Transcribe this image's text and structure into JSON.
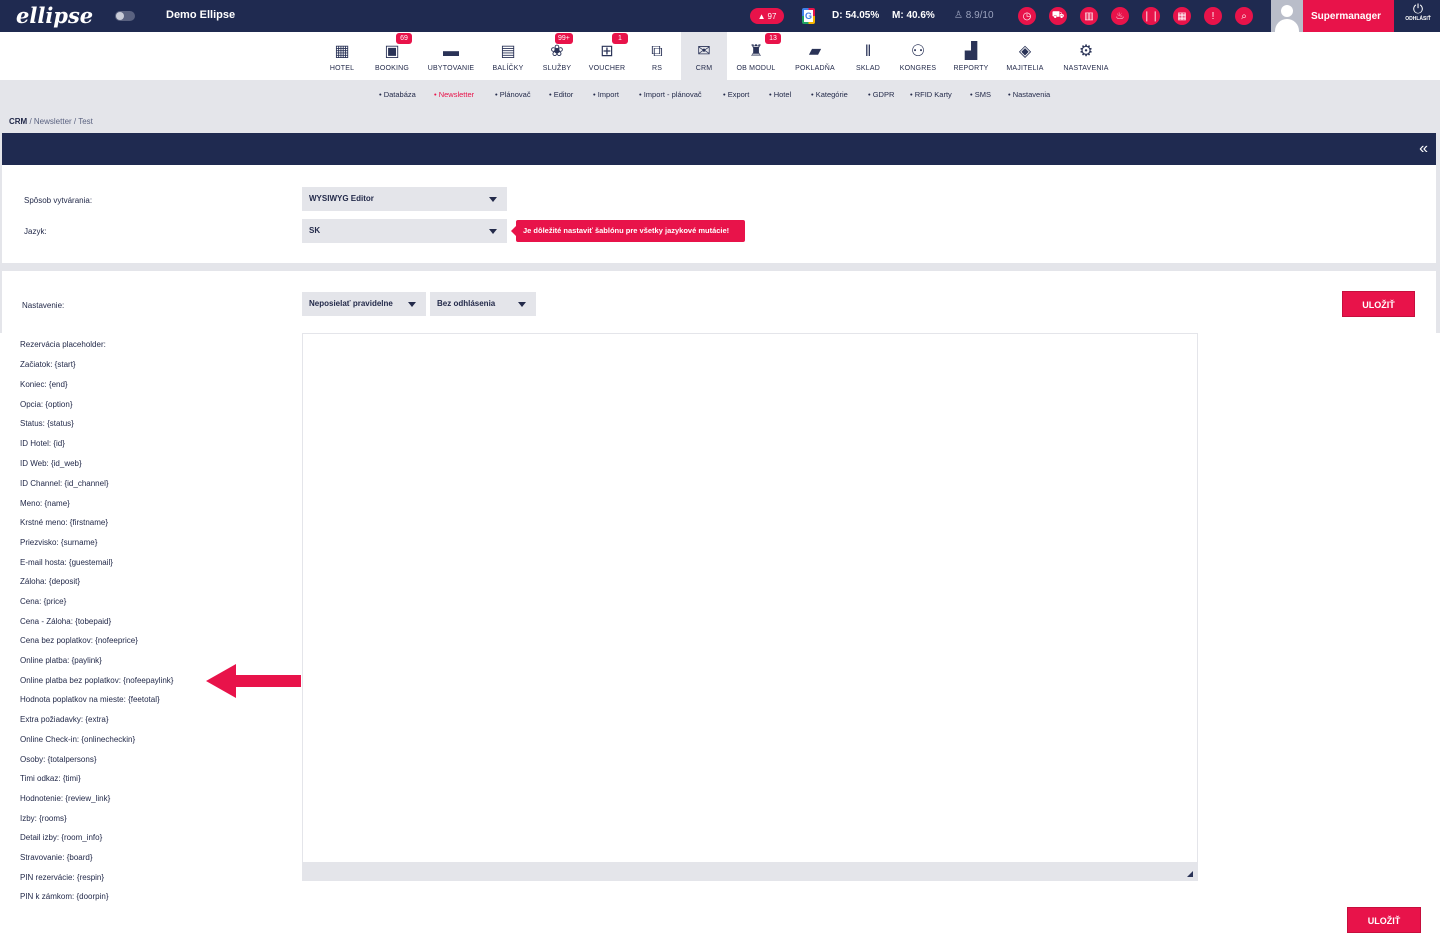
{
  "topbar": {
    "logo": "ellipse",
    "demo_label": "Demo Ellipse",
    "alerts_count": "97",
    "occupancy_day": "D: 54.05%",
    "occupancy_month": "M: 40.6%",
    "rating": "8.9/10",
    "user_name": "Supermanager",
    "logout_label": "ODHLÁSIŤ",
    "icons": [
      "clock-24-icon",
      "car-icon",
      "chart-icon",
      "restaurant-icon",
      "cutlery-icon",
      "calendar-icon",
      "alert-icon",
      "search-icon"
    ]
  },
  "modules": [
    {
      "label": "HOTEL",
      "icon": "building-icon",
      "badge": ""
    },
    {
      "label": "BOOKING",
      "icon": "calendar-icon",
      "badge": "69"
    },
    {
      "label": "UBYTOVANIE",
      "icon": "bed-icon",
      "badge": ""
    },
    {
      "label": "BALÍČKY",
      "icon": "package-icon",
      "badge": ""
    },
    {
      "label": "SLUŽBY",
      "icon": "spa-icon",
      "badge": "99+"
    },
    {
      "label": "VOUCHER",
      "icon": "gift-icon",
      "badge": "1"
    },
    {
      "label": "RS",
      "icon": "code-icon",
      "badge": ""
    },
    {
      "label": "CRM",
      "icon": "envelope-icon",
      "badge": ""
    },
    {
      "label": "OB MODUL",
      "icon": "store-icon",
      "badge": "13"
    },
    {
      "label": "POKLADŇA",
      "icon": "wallet-icon",
      "badge": ""
    },
    {
      "label": "SKLAD",
      "icon": "cutlery-icon",
      "badge": ""
    },
    {
      "label": "KONGRES",
      "icon": "people-icon",
      "badge": ""
    },
    {
      "label": "REPORTY",
      "icon": "report-icon",
      "badge": ""
    },
    {
      "label": "MAJITELIA",
      "icon": "handshake-icon",
      "badge": ""
    },
    {
      "label": "NASTAVENIA",
      "icon": "gears-icon",
      "badge": ""
    }
  ],
  "subnav": [
    "• Databáza",
    "• Newsletter",
    "• Plánovač",
    "• Editor",
    "• Import",
    "• Import - plánovač",
    "• Export",
    "• Hotel",
    "• Kategórie",
    "• GDPR",
    "• RFID Karty",
    "• SMS",
    "• Nastavenia"
  ],
  "breadcrumb": {
    "root": "CRM",
    "rest": " / Newsletter / Test"
  },
  "form": {
    "creation_label": "Spôsob vytvárania:",
    "creation_value": "WYSIWYG Editor",
    "language_label": "Jazyk:",
    "language_value": "SK",
    "language_tooltip": "Je dôležité nastaviť šablónu pre všetky jazykové mutácie!",
    "settings_label": "Nastavenie:",
    "schedule_value": "Neposielať pravidelne",
    "unsubscribe_value": "Bez odhlásenia",
    "save_label": "ULOŽIŤ"
  },
  "placeholders": [
    "Rezervácia placeholder:",
    "Začiatok: {start}",
    "Koniec: {end}",
    "Opcia: {option}",
    "Status: {status}",
    "ID Hotel: {id}",
    "ID Web: {id_web}",
    "ID Channel: {id_channel}",
    "Meno: {name}",
    "Krstné meno: {firstname}",
    "Priezvisko: {surname}",
    "E-mail hosta: {guestemail}",
    "Záloha: {deposit}",
    "Cena: {price}",
    "Cena - Záloha: {tobepaid}",
    "Cena bez poplatkov: {nofeeprice}",
    "Online platba: {paylink}",
    "Online platba bez poplatkov: {nofeepaylink}",
    "Hodnota poplatkov na mieste: {feetotal}",
    "Extra požiadavky: {extra}",
    "Online Check-in: {onlinecheckin}",
    "Osoby: {totalpersons}",
    "Timi odkaz: {timi}",
    "Hodnotenie: {review_link}",
    "Izby: {rooms}",
    "Detail izby: {room_info}",
    "Stravovanie: {board}",
    "PIN rezervácie: {respin}",
    "PIN k zámkom: {doorpin}"
  ],
  "colors": {
    "navy": "#1f2a50",
    "accent": "#e8134a",
    "bg": "#e4e5ea"
  }
}
